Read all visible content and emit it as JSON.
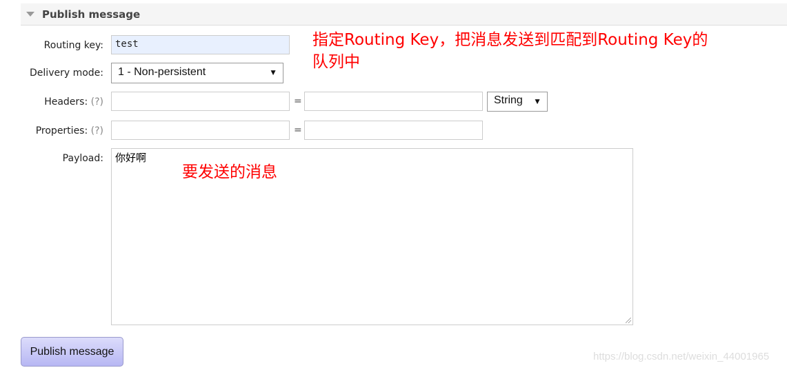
{
  "section": {
    "title": "Publish message",
    "icon": "triangle-down-icon"
  },
  "form": {
    "routing_key": {
      "label": "Routing key:",
      "value": "test"
    },
    "delivery_mode": {
      "label": "Delivery mode:",
      "value": "1 - Non-persistent"
    },
    "headers": {
      "label": "Headers:",
      "help": "(?)",
      "equals": "=",
      "type": "String"
    },
    "properties": {
      "label": "Properties:",
      "help": "(?)",
      "equals": "="
    },
    "payload": {
      "label": "Payload:",
      "value": "你好啊"
    }
  },
  "publish_button": "Publish message",
  "annotations": {
    "routing_line1": "指定Routing Key，把消息发送到匹配到Routing Key的",
    "routing_line2": "队列中",
    "payload": "要发送的消息"
  },
  "watermark": "https://blog.csdn.net/weixin_44001965",
  "colors": {
    "annotation": "#ff0000",
    "button": "#c8c8f7",
    "routing_bg": "#e8f0fe"
  }
}
